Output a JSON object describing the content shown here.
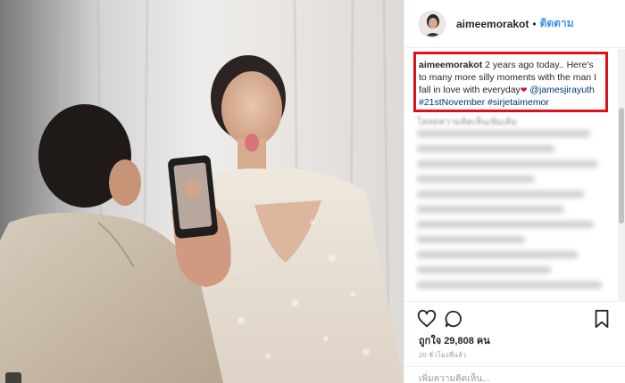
{
  "post": {
    "username": "aimeemorakot",
    "dot": "•",
    "follow_label": "ติดตาม"
  },
  "caption": {
    "username": "aimeemorakot",
    "text": "2 years ago today.. Here's to many more silly moments with the man I fall in love with everyday",
    "heart": "❤",
    "mention": "@jamesjirayuth",
    "hashtag1": "#21stNovember",
    "hashtag2": "#sirjetaimemor"
  },
  "comments": {
    "load_more_label": "โหลดความคิดเห็นเพิ่มเติม"
  },
  "stats": {
    "likes_label": "ถูกใจ 29,808 คน",
    "timestamp": "20 ชั่วโมงที่แล้ว"
  },
  "add_comment": {
    "placeholder": "เพิ่มความคิดเห็น..."
  },
  "icons": {
    "like": "heart-outline-icon",
    "comment": "comment-bubble-icon",
    "save": "bookmark-icon"
  }
}
